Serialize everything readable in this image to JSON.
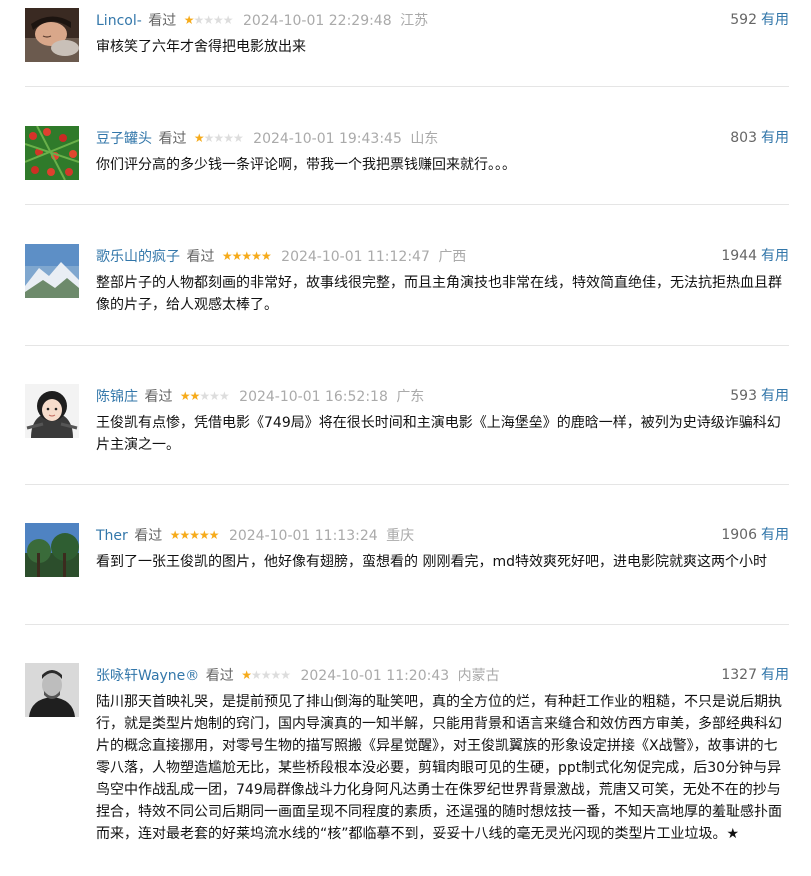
{
  "comments": [
    {
      "user": "Lincol-",
      "watched": "看过",
      "rating": 1,
      "time": "2024-10-01 22:29:48",
      "location": "江苏",
      "votes": "592",
      "useful": "有用",
      "text": "审核笑了六年才舍得把电影放出来",
      "avatar_icon": "sleeping-person-avatar"
    },
    {
      "user": "豆子罐头",
      "watched": "看过",
      "rating": 1,
      "time": "2024-10-01 19:43:45",
      "location": "山东",
      "votes": "803",
      "useful": "有用",
      "text": "你们评分高的多少钱一条评论啊，带我一个我把票钱赚回来就行。。。",
      "avatar_icon": "green-berries-avatar"
    },
    {
      "user": "歌乐山的疯子",
      "watched": "看过",
      "rating": 5,
      "time": "2024-10-01 11:12:47",
      "location": "广西",
      "votes": "1944",
      "useful": "有用",
      "text": "整部片子的人物都刻画的非常好，故事线很完整，而且主角演技也非常在线，特效简直绝佳，无法抗拒热血且群像的片子，给人观感太棒了。",
      "avatar_icon": "snow-mountain-avatar"
    },
    {
      "user": "陈锦庄",
      "watched": "看过",
      "rating": 2,
      "time": "2024-10-01 16:52:18",
      "location": "广东",
      "votes": "593",
      "useful": "有用",
      "text": "王俊凯有点惨，凭借电影《749局》将在很长时间和主演电影《上海堡垒》的鹿晗一样，被列为史诗级诈骗科幻片主演之一。",
      "avatar_icon": "cartoon-girl-avatar"
    },
    {
      "user": "Ther",
      "watched": "看过",
      "rating": 5,
      "time": "2024-10-01 11:13:24",
      "location": "重庆",
      "votes": "1906",
      "useful": "有用",
      "text": "看到了一张王俊凯的图片，他好像有翅膀，蛮想看的 刚刚看完，md特效爽死好吧，进电影院就爽这两个小时",
      "avatar_icon": "tree-sky-avatar"
    },
    {
      "user": "张咏轩Wayne®",
      "watched": "看过",
      "rating": 1,
      "time": "2024-10-01 11:20:43",
      "location": "内蒙古",
      "votes": "1327",
      "useful": "有用",
      "text": "陆川那天首映礼哭，是提前预见了排山倒海的耻笑吧，真的全方位的烂，有种赶工作业的粗糙，不只是说后期执行，就是类型片炮制的窍门，国内导演真的一知半解，只能用背景和语言来缝合和效仿西方审美，多部经典科幻片的概念直接挪用，对零号生物的描写照搬《异星觉醒》，对王俊凯翼族的形象设定拼接《X战警》，故事讲的七零八落，人物塑造尴尬无比，某些桥段根本没必要，剪辑肉眼可见的生硬，ppt制式化匆促完成，后30分钟与异鸟空中作战乱成一团，749局群像战斗力化身阿凡达勇士在侏罗纪世界背景激战，荒唐又可笑，无处不在的抄与捏合，特效不同公司后期同一画面呈现不同程度的素质，还逞强的随时想炫技一番，不知天高地厚的羞耻感扑面而来，连对最老套的好莱坞流水线的“核”都临摹不到，妥妥十八线的毫无灵光闪现的类型片工业垃圾。★",
      "avatar_icon": "man-portrait-avatar"
    }
  ]
}
